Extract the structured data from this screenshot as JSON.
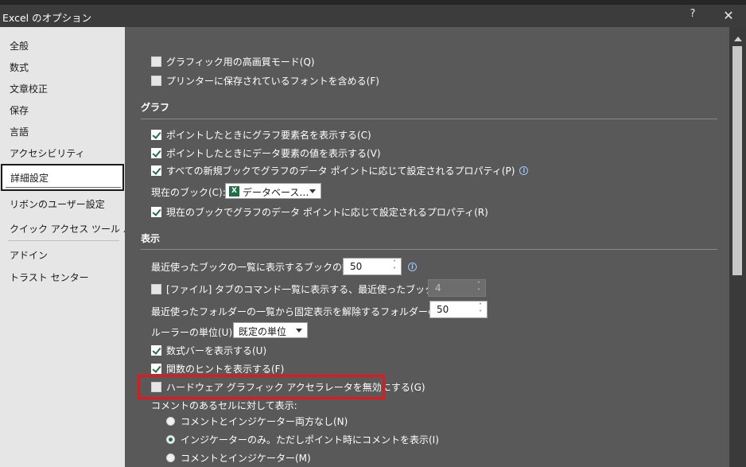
{
  "window": {
    "title": "Excel のオプション",
    "help": "?",
    "close": "✕"
  },
  "nav": {
    "items": [
      {
        "label": "全般"
      },
      {
        "label": "数式"
      },
      {
        "label": "文章校正"
      },
      {
        "label": "保存"
      },
      {
        "label": "言語"
      },
      {
        "label": "アクセシビリティ"
      },
      {
        "label": "詳細設定",
        "selected": true
      },
      {
        "label": "リボンのユーザー設定"
      },
      {
        "label": "クイック アクセス ツール バー"
      },
      {
        "label": "アドイン"
      },
      {
        "label": "トラスト センター"
      }
    ]
  },
  "print": {
    "high_quality": {
      "label": "グラフィック用の高画質モード(Q)",
      "checked": false
    },
    "printer_fonts": {
      "label": "プリンターに保存されているフォントを含める(F)",
      "checked": false
    }
  },
  "chart": {
    "heading": "グラフ",
    "hover_name": {
      "label": "ポイントしたときにグラフ要素名を表示する(C)",
      "checked": true
    },
    "hover_value": {
      "label": "ポイントしたときにデータ要素の値を表示する(V)",
      "checked": true
    },
    "all_new_books": {
      "label": "すべての新規ブックでグラフのデータ ポイントに応じて設定されるプロパティ(P)",
      "checked": true
    },
    "current_book_label": "現在のブック(C):",
    "current_book_value": "データベース…",
    "current_book_prop": {
      "label": "現在のブックでグラフのデータ ポイントに応じて設定されるプロパティ(R)",
      "checked": true
    }
  },
  "display": {
    "heading": "表示",
    "recent_books_label": "最近使ったブックの一覧に表示するブックの数(R):",
    "recent_books_value": "50",
    "quick_access_label": "[ファイル] タブのコマンド一覧に表示する、最近使ったブックの数(Q):",
    "quick_access_value": "4",
    "quick_access_checked": false,
    "recent_folders_label": "最近使ったフォルダーの一覧から固定表示を解除するフォルダーの数(F):",
    "recent_folders_value": "50",
    "ruler_label": "ルーラーの単位(U)",
    "ruler_value": "既定の単位",
    "formula_bar": {
      "label": "数式バーを表示する(U)",
      "checked": true
    },
    "function_tips": {
      "label": "関数のヒントを表示する(F)",
      "checked": true
    },
    "disable_hw_accel": {
      "label": "ハードウェア グラフィック アクセラレータを無効にする(G)",
      "checked": false
    },
    "comments_label": "コメントのあるセルに対して表示:",
    "comment_none": {
      "label": "コメントとインジケーター両方なし(N)",
      "selected": false
    },
    "comment_indicator": {
      "label": "インジケーターのみ。ただしポイント時にコメントを表示(I)",
      "selected": true
    },
    "comment_both": {
      "label": "コメントとインジケーター(M)",
      "selected": false
    }
  },
  "colors": {
    "highlight": "#e8151b",
    "check": "#1e7145"
  }
}
